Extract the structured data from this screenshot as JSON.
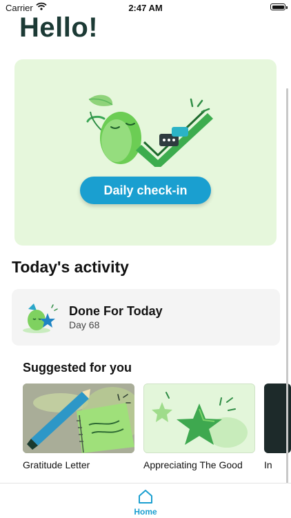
{
  "status_bar": {
    "carrier": "Carrier",
    "time": "2:47 AM"
  },
  "greeting": "Hello!",
  "hero": {
    "button_label": "Daily check-in"
  },
  "today": {
    "title": "Today's activity",
    "activity": {
      "title": "Done For Today",
      "subtitle": "Day 68"
    }
  },
  "suggested": {
    "title": "Suggested for you",
    "items": [
      {
        "label": "Gratitude Letter"
      },
      {
        "label": "Appreciating The Good"
      },
      {
        "label": "In"
      }
    ]
  },
  "tab_bar": {
    "home_label": "Home",
    "active": "Home"
  },
  "colors": {
    "accent": "#1a9fd0",
    "hero_bg": "#e6f7dc",
    "title": "#1c3a35"
  },
  "icons": [
    "wifi-icon",
    "battery-icon",
    "home-icon"
  ]
}
